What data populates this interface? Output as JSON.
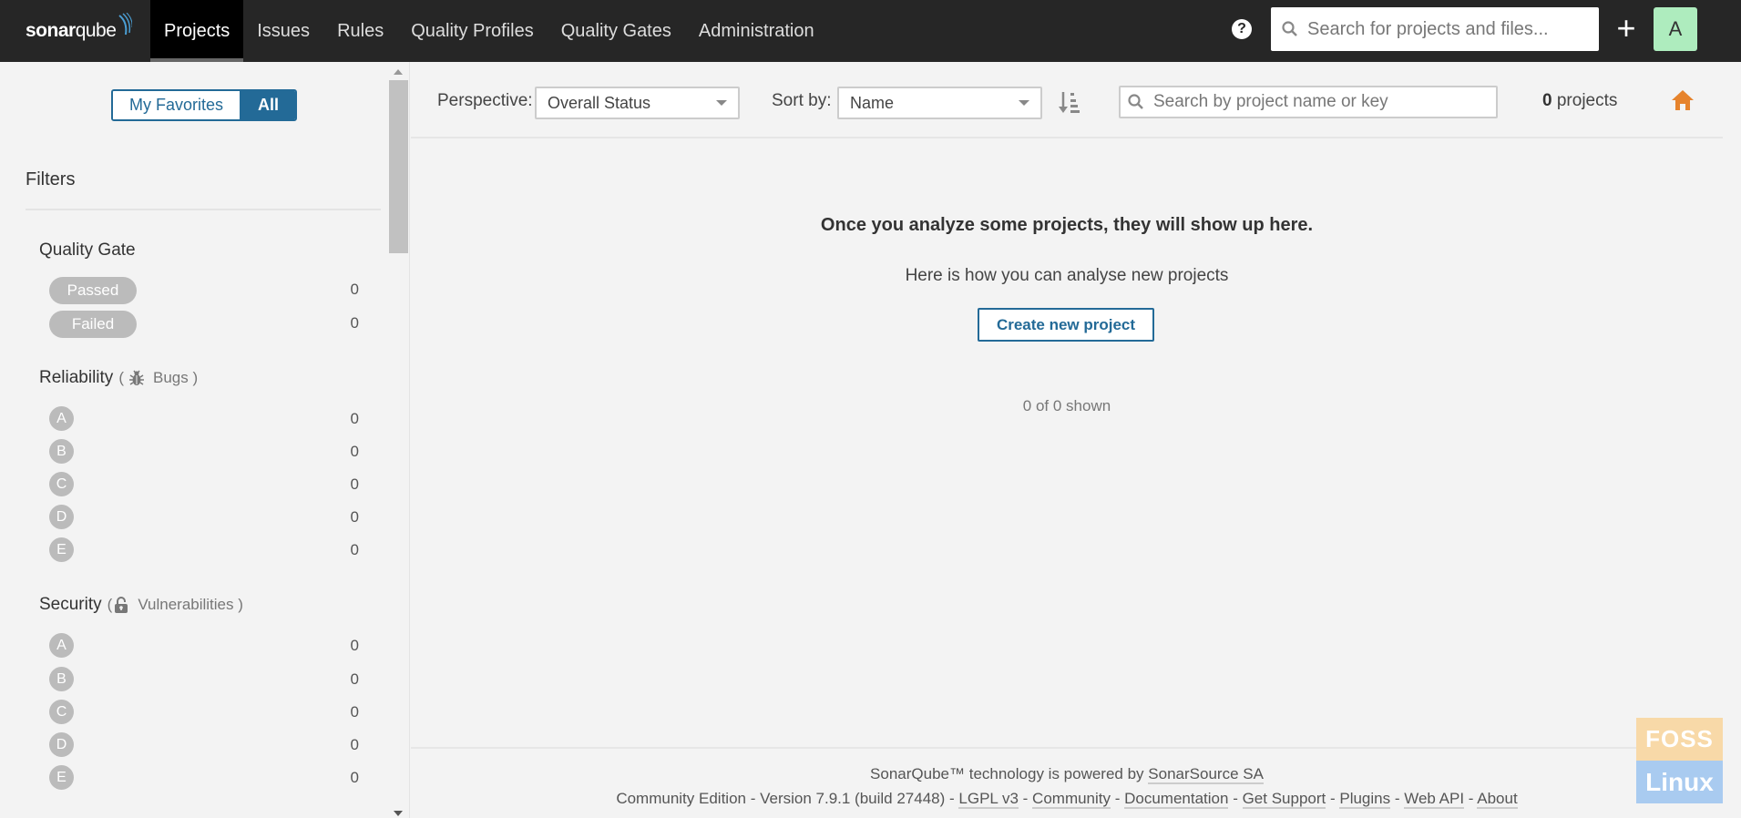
{
  "nav": {
    "logo": {
      "bold": "sonar",
      "light": "qube"
    },
    "items": [
      {
        "label": "Projects",
        "active": true
      },
      {
        "label": "Issues"
      },
      {
        "label": "Rules"
      },
      {
        "label": "Quality Profiles"
      },
      {
        "label": "Quality Gates"
      },
      {
        "label": "Administration"
      }
    ],
    "help_icon": "?",
    "search_placeholder": "Search for projects and files...",
    "create_icon": "+",
    "avatar_letter": "A",
    "colors": {
      "bar": "#262626",
      "avatar": "#aeecbe"
    }
  },
  "sidebar": {
    "toggle": {
      "favorites": "My Favorites",
      "all": "All",
      "selected": "All"
    },
    "filters_title": "Filters",
    "quality_gate": {
      "title": "Quality Gate",
      "options": [
        {
          "label": "Passed",
          "count": "0"
        },
        {
          "label": "Failed",
          "count": "0"
        }
      ]
    },
    "reliability": {
      "title": "Reliability",
      "paren_open": "(",
      "icon": "bug-icon",
      "sub": "Bugs )",
      "ratings": [
        {
          "label": "A",
          "count": "0"
        },
        {
          "label": "B",
          "count": "0"
        },
        {
          "label": "C",
          "count": "0"
        },
        {
          "label": "D",
          "count": "0"
        },
        {
          "label": "E",
          "count": "0"
        }
      ]
    },
    "security": {
      "title": "Security",
      "paren_open": "(",
      "icon": "unlock-icon",
      "sub": "Vulnerabilities )",
      "ratings": [
        {
          "label": "A",
          "count": "0"
        },
        {
          "label": "B",
          "count": "0"
        },
        {
          "label": "C",
          "count": "0"
        },
        {
          "label": "D",
          "count": "0"
        },
        {
          "label": "E",
          "count": "0"
        }
      ]
    }
  },
  "toolbar": {
    "perspective_label": "Perspective:",
    "perspective_value": "Overall Status",
    "sort_label": "Sort by:",
    "sort_value": "Name",
    "search_placeholder": "Search by project name or key",
    "project_count": "0",
    "project_count_suffix": " projects",
    "accent_color": "#e6832c"
  },
  "empty": {
    "title": "Once you analyze some projects, they will show up here.",
    "subtitle": "Here is how you can analyse new projects",
    "create_button": "Create new project",
    "shown": "0 of 0 shown"
  },
  "footer": {
    "powered_text": "SonarQube™ technology is powered by ",
    "powered_link": "SonarSource SA",
    "edition": "Community Edition",
    "version": "Version 7.9.1 (build 27448)",
    "links": [
      "LGPL v3",
      "Community",
      "Documentation",
      "Get Support",
      "Plugins",
      "Web API",
      "About"
    ],
    "separator": " - "
  },
  "watermark": {
    "top": "FOSS",
    "bottom": "Linux"
  }
}
